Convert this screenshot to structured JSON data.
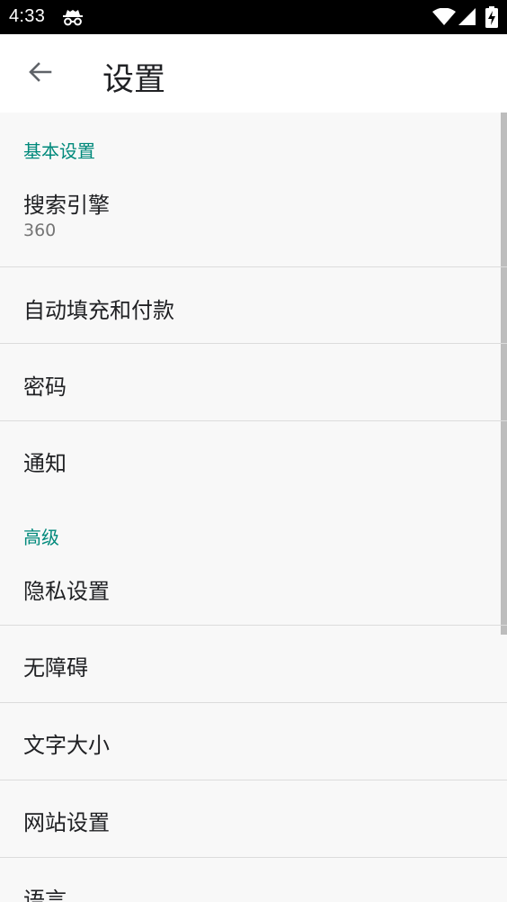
{
  "status_bar": {
    "time": "4:33",
    "icons": [
      "incognito-icon",
      "wifi-icon",
      "cell-signal-icon",
      "battery-charging-icon"
    ]
  },
  "app_bar": {
    "back_icon": "arrow-back-icon",
    "title": "设置"
  },
  "sections": {
    "basic": {
      "header": "基本设置",
      "search_engine": {
        "label": "搜索引擎",
        "value": "360"
      },
      "autofill": "自动填充和付款",
      "passwords": "密码",
      "notifications": "通知"
    },
    "advanced": {
      "header": "高级",
      "privacy": "隐私设置",
      "accessibility": "无障碍",
      "text_size": "文字大小",
      "site_settings": "网站设置",
      "language": "语言"
    }
  },
  "colors": {
    "accent": "#00897b",
    "text_primary": "#202124",
    "text_secondary": "#757575",
    "background": "#f8f8f8"
  }
}
